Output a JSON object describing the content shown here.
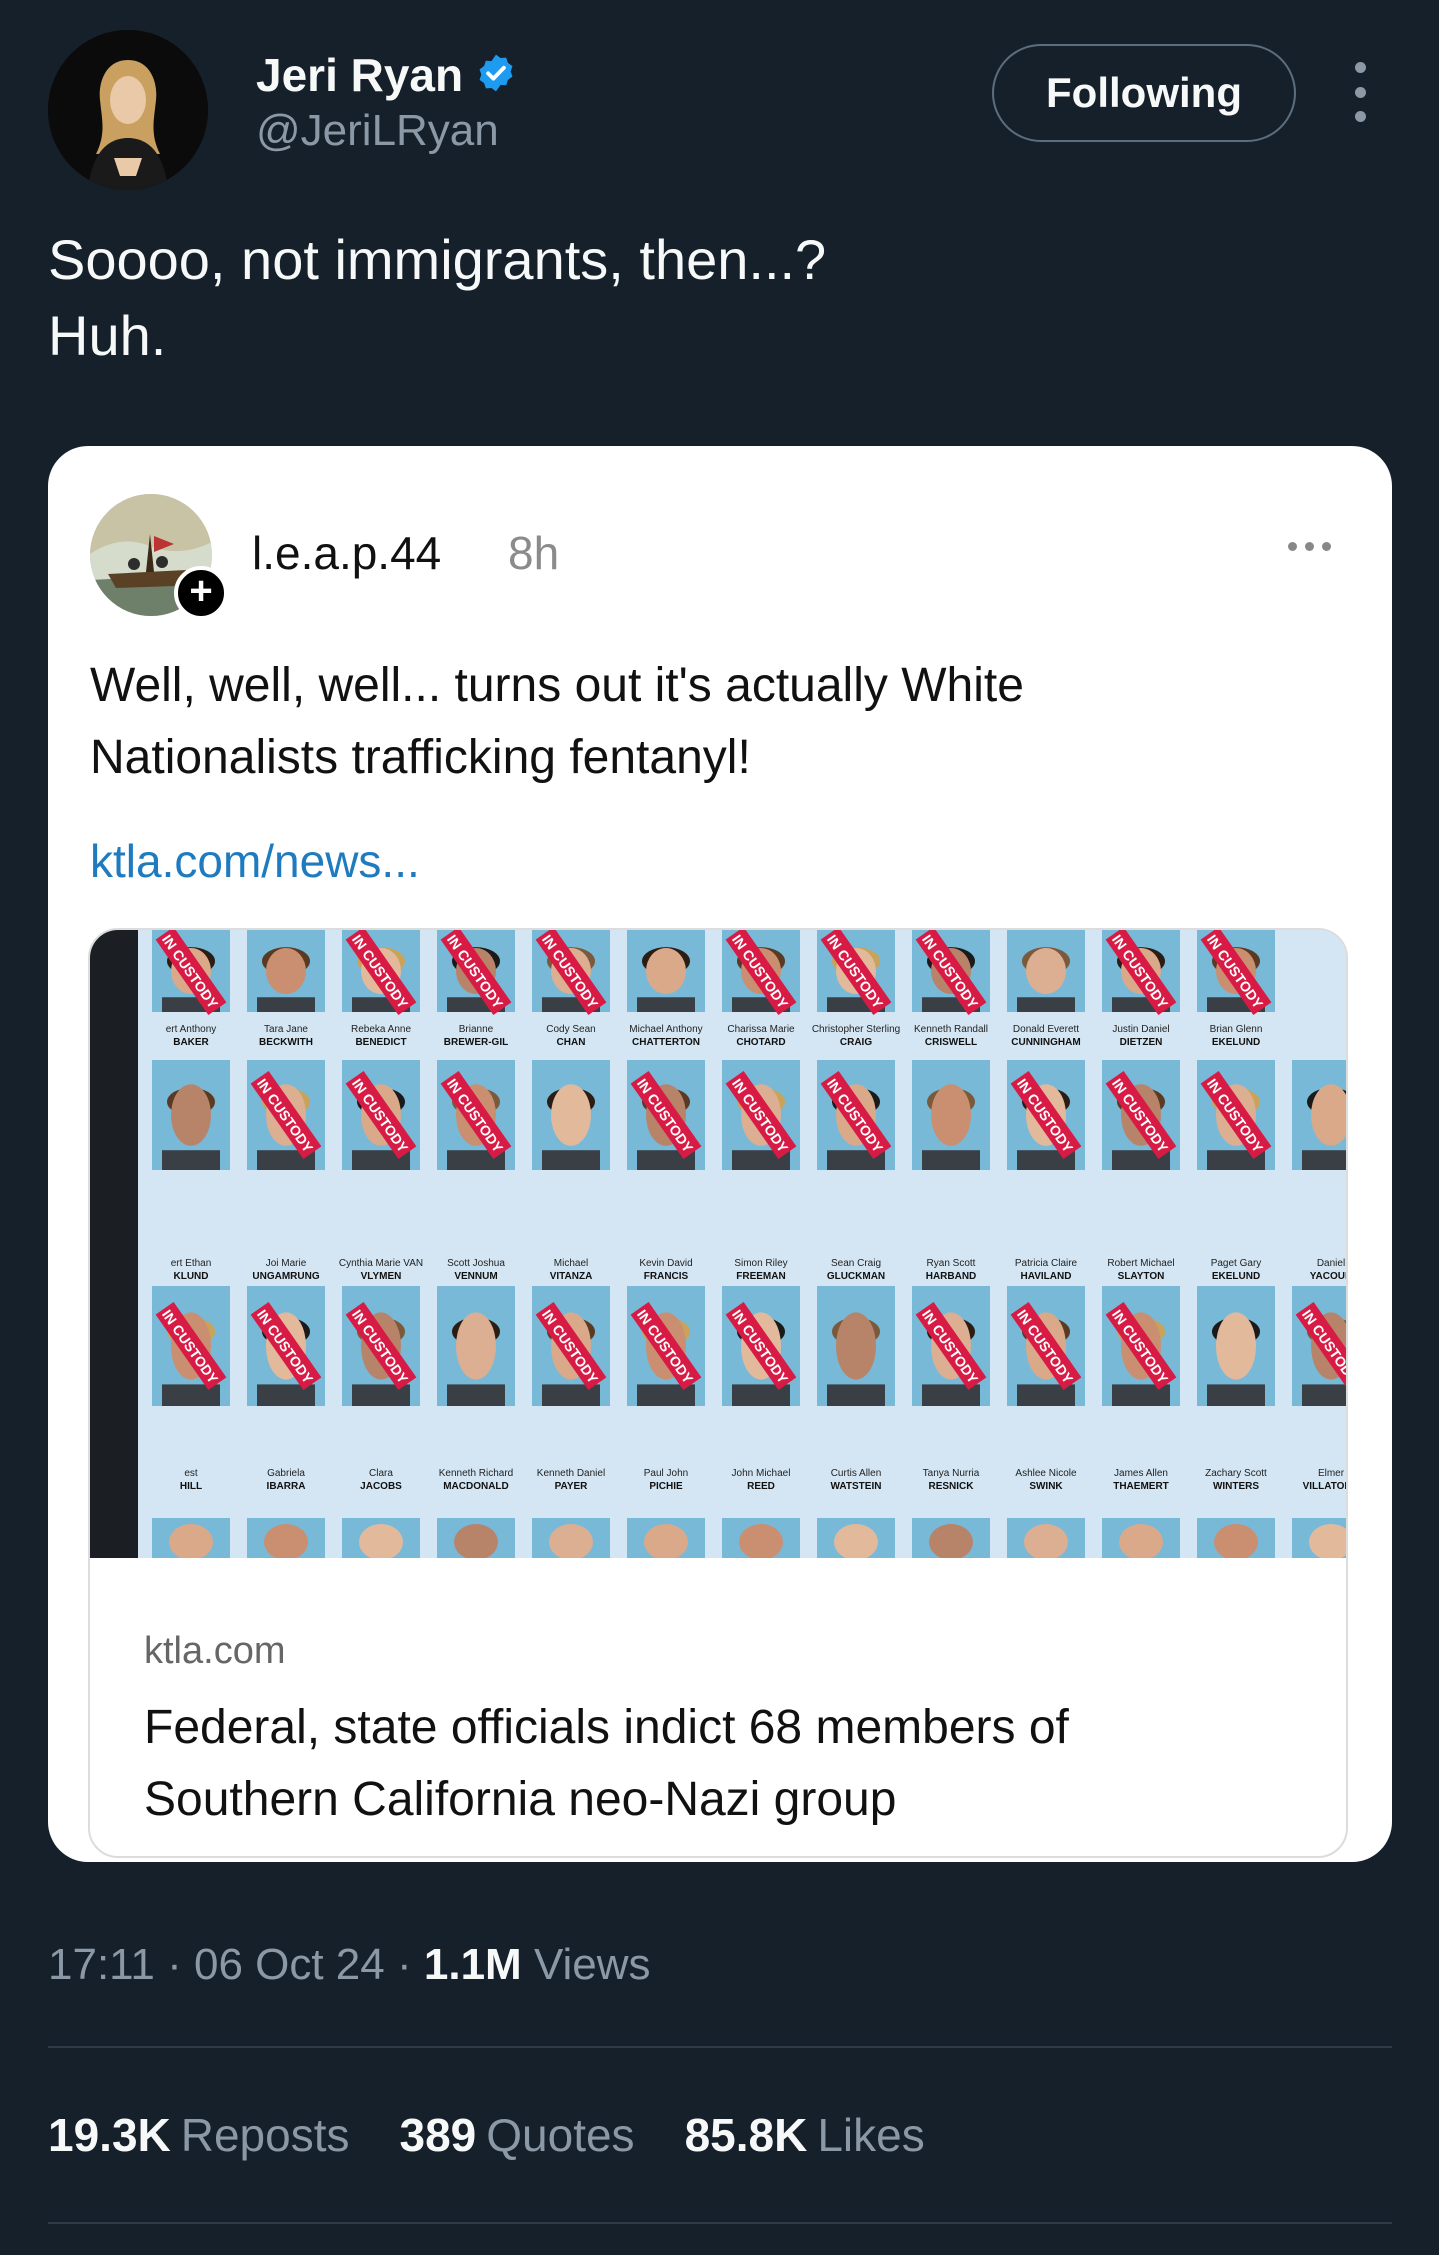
{
  "author": {
    "display_name": "Jeri Ryan",
    "handle": "@JeriLRyan",
    "verified": true
  },
  "follow_button": "Following",
  "tweet": {
    "lines": [
      "Soooo, not immigrants, then...?",
      "Huh."
    ]
  },
  "quote": {
    "username": "l.e.a.p.44",
    "time": "8h",
    "text_lines": [
      "Well, well, well... turns out it's actually White",
      "Nationalists trafficking fentanyl!"
    ],
    "link": "ktla.com/news...",
    "card": {
      "domain": "ktla.com",
      "title_lines": [
        "Federal, state officials indict 68 members of",
        "Southern California neo-Nazi group"
      ],
      "image_labels": {
        "stamp": "IN CUSTODY",
        "row1": [
          "ert Anthony BAKER",
          "Tara Jane BECKWITH",
          "Rebeka Anne BENEDICT",
          "Brianne BREWER-GIL",
          "Cody Sean CHAN",
          "Michael Anthony CHATTERTON",
          "Charissa Marie CHOTARD",
          "Christopher Sterling CRAIG",
          "Kenneth Randall CRISWELL",
          "Donald Everett CUNNINGHAM",
          "Justin Daniel DIETZEN",
          "Brian Glenn EKELUND"
        ],
        "row2": [
          "ert Ethan KLUND",
          "Joi Marie UNGAMRUNG",
          "Cynthia Marie VAN VLYMEN",
          "Scott Joshua VENNUM",
          "Michael VITANZA",
          "Kevin David FRANCIS",
          "Simon Riley FREEMAN",
          "Sean Craig GLUCKMAN",
          "Ryan Scott HARBAND",
          "Patricia Claire HAVILAND",
          "Robert Michael SLAYTON",
          "Paget Gary EKELUND",
          "Daniel YACOUB"
        ],
        "row3": [
          "est HILL",
          "Gabriela IBARRA",
          "Clara JACOBS",
          "Kenneth Richard MACDONALD",
          "Kenneth Daniel PAYER",
          "Paul John PICHIE",
          "John Michael REED",
          "Curtis Allen WATSTEIN",
          "Tanya Nurria RESNICK",
          "Ashlee Nicole SWINK",
          "James Allen THAEMERT",
          "Zachary Scott WINTERS",
          "Elmer VILLATORO"
        ]
      }
    }
  },
  "meta": {
    "time": "17:11",
    "date": "06 Oct 24",
    "views_count": "1.1M",
    "views_label": "Views"
  },
  "stats": {
    "reposts_count": "19.3K",
    "reposts_label": "Reposts",
    "quotes_count": "389",
    "quotes_label": "Quotes",
    "likes_count": "85.8K",
    "likes_label": "Likes"
  },
  "colors": {
    "background": "#16202b",
    "verified": "#1d9bf0",
    "link": "#1f7bbf",
    "stamp": "#d81b45"
  }
}
